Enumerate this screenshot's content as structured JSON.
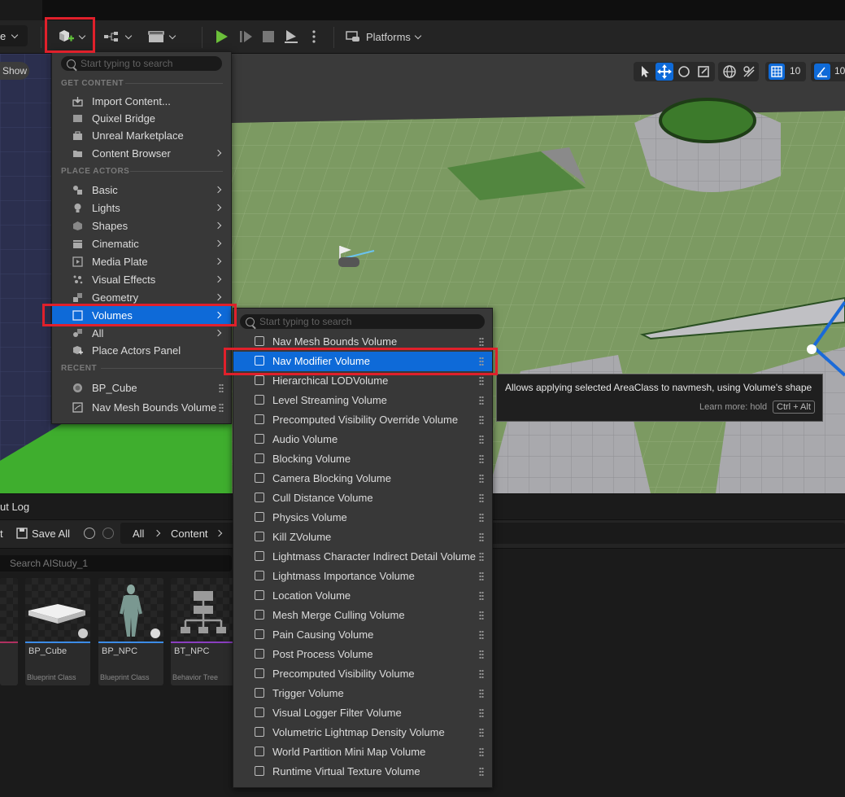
{
  "toolbar": {
    "mode_partial": "e",
    "platforms_label": "Platforms",
    "show_label": "Show",
    "grid_value": "10",
    "angle_value": "10"
  },
  "quick_add_menu": {
    "search_placeholder": "Start typing to search",
    "get_content_header": "GET CONTENT",
    "get_content_items": [
      {
        "label": "Import Content...",
        "icon": "import-icon"
      },
      {
        "label": "Quixel Bridge",
        "icon": "quixel-icon"
      },
      {
        "label": "Unreal Marketplace",
        "icon": "marketplace-icon"
      },
      {
        "label": "Content Browser",
        "icon": "folder-icon"
      }
    ],
    "place_actors_header": "PLACE ACTORS",
    "place_actors_items": [
      {
        "label": "Basic",
        "icon": "basic-icon"
      },
      {
        "label": "Lights",
        "icon": "light-icon"
      },
      {
        "label": "Shapes",
        "icon": "shapes-icon"
      },
      {
        "label": "Cinematic",
        "icon": "cinematic-icon"
      },
      {
        "label": "Media Plate",
        "icon": "media-icon"
      },
      {
        "label": "Visual Effects",
        "icon": "effects-icon"
      },
      {
        "label": "Geometry",
        "icon": "geometry-icon"
      },
      {
        "label": "Volumes",
        "icon": "volume-icon"
      },
      {
        "label": "All",
        "icon": "all-icon"
      },
      {
        "label": "Place Actors Panel",
        "icon": "place-actors-icon"
      }
    ],
    "recent_header": "RECENT",
    "recent_items": [
      {
        "label": "BP_Cube",
        "icon": "blueprint-icon"
      },
      {
        "label": "Nav Mesh Bounds Volume",
        "icon": "navmesh-icon"
      }
    ]
  },
  "volumes_submenu": {
    "search_placeholder": "Start typing to search",
    "items": [
      "Nav Mesh Bounds Volume",
      "Nav Modifier Volume",
      "Hierarchical LODVolume",
      "Level Streaming Volume",
      "Precomputed Visibility Override Volume",
      "Audio Volume",
      "Blocking Volume",
      "Camera Blocking Volume",
      "Cull Distance Volume",
      "Physics Volume",
      "Kill ZVolume",
      "Lightmass Character Indirect Detail Volume",
      "Lightmass Importance Volume",
      "Location Volume",
      "Mesh Merge Culling Volume",
      "Pain Causing Volume",
      "Post Process Volume",
      "Precomputed Visibility Volume",
      "Trigger Volume",
      "Visual Logger Filter Volume",
      "Volumetric Lightmap Density Volume",
      "World Partition Mini Map Volume",
      "Runtime Virtual Texture Volume"
    ],
    "selected_index": 1
  },
  "tooltip": {
    "text": "Allows applying selected AreaClass to navmesh, using Volume's shape",
    "learn_more": "Learn more: hold",
    "shortcut": "Ctrl + Alt"
  },
  "content_browser": {
    "tab_label": "ut Log",
    "add_partial": "t",
    "save_all": "Save All",
    "path": [
      "All",
      "Content"
    ],
    "search_placeholder": "Search AIStudy_1",
    "assets": [
      {
        "name": "BP_Cube",
        "type": "Blueprint Class"
      },
      {
        "name": "BP_NPC",
        "type": "Blueprint Class"
      },
      {
        "name": "BT_NPC",
        "type": "Behavior Tree"
      }
    ]
  },
  "colors": {
    "highlight": "#0e6ad8",
    "annotation_red": "#e0202b",
    "play_green": "#6bbf3a"
  }
}
